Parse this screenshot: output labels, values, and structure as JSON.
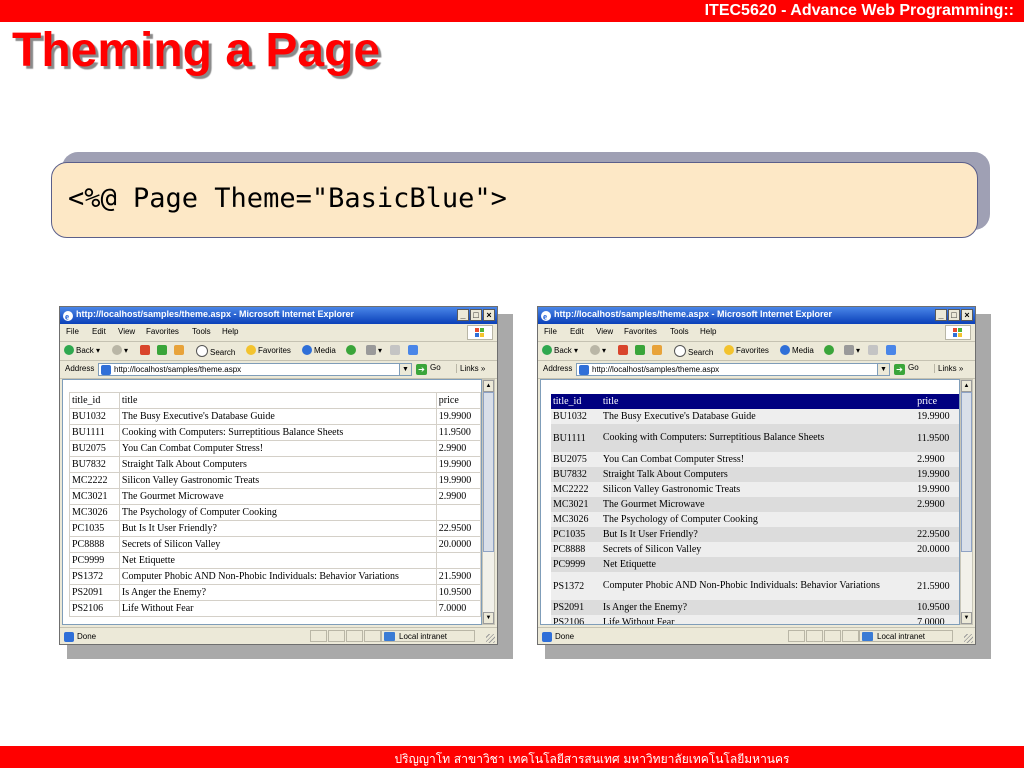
{
  "header": {
    "course": "ITEC5620 - Advance Web Programming::"
  },
  "slide": {
    "title": "Theming a Page"
  },
  "code": {
    "text": "<%@ Page Theme=\"BasicBlue\">"
  },
  "browser": {
    "title": "http://localhost/samples/theme.aspx - Microsoft Internet Explorer",
    "menu": [
      "File",
      "Edit",
      "View",
      "Favorites",
      "Tools",
      "Help"
    ],
    "toolbar": {
      "back": "Back",
      "search": "Search",
      "favorites": "Favorites",
      "media": "Media"
    },
    "address_label": "Address",
    "address": "http://localhost/samples/theme.aspx",
    "go": "Go",
    "links": "Links",
    "status": "Done",
    "zone": "Local intranet"
  },
  "table": {
    "columns": [
      "title_id",
      "title",
      "price"
    ],
    "rows": [
      [
        "BU1032",
        "The Busy Executive's Database Guide",
        "19.9900"
      ],
      [
        "BU1111",
        "Cooking with Computers: Surreptitious Balance Sheets",
        "11.9500"
      ],
      [
        "BU2075",
        "You Can Combat Computer Stress!",
        "2.9900"
      ],
      [
        "BU7832",
        "Straight Talk About Computers",
        "19.9900"
      ],
      [
        "MC2222",
        "Silicon Valley Gastronomic Treats",
        "19.9900"
      ],
      [
        "MC3021",
        "The Gourmet Microwave",
        "2.9900"
      ],
      [
        "MC3026",
        "The Psychology of Computer Cooking",
        ""
      ],
      [
        "PC1035",
        "But Is It User Friendly?",
        "22.9500"
      ],
      [
        "PC8888",
        "Secrets of Silicon Valley",
        "20.0000"
      ],
      [
        "PC9999",
        "Net Etiquette",
        ""
      ],
      [
        "PS1372",
        "Computer Phobic AND Non-Phobic Individuals: Behavior Variations",
        "21.5900"
      ],
      [
        "PS2091",
        "Is Anger the Enemy?",
        "10.9500"
      ],
      [
        "PS2106",
        "Life Without Fear",
        "7.0000"
      ]
    ]
  },
  "footer": {
    "text": "ปริญญาโท สาขาวิชา เทคโนโลยีสารสนเทศ  มหาวิทยาลัยเทคโนโลยีมหานคร"
  },
  "colors": {
    "accent": "#ff0000",
    "code_bg": "#fde8c6",
    "theme_header": "#000080",
    "row_alt_a": "#eeeeee",
    "row_alt_b": "#dcdcdc"
  }
}
